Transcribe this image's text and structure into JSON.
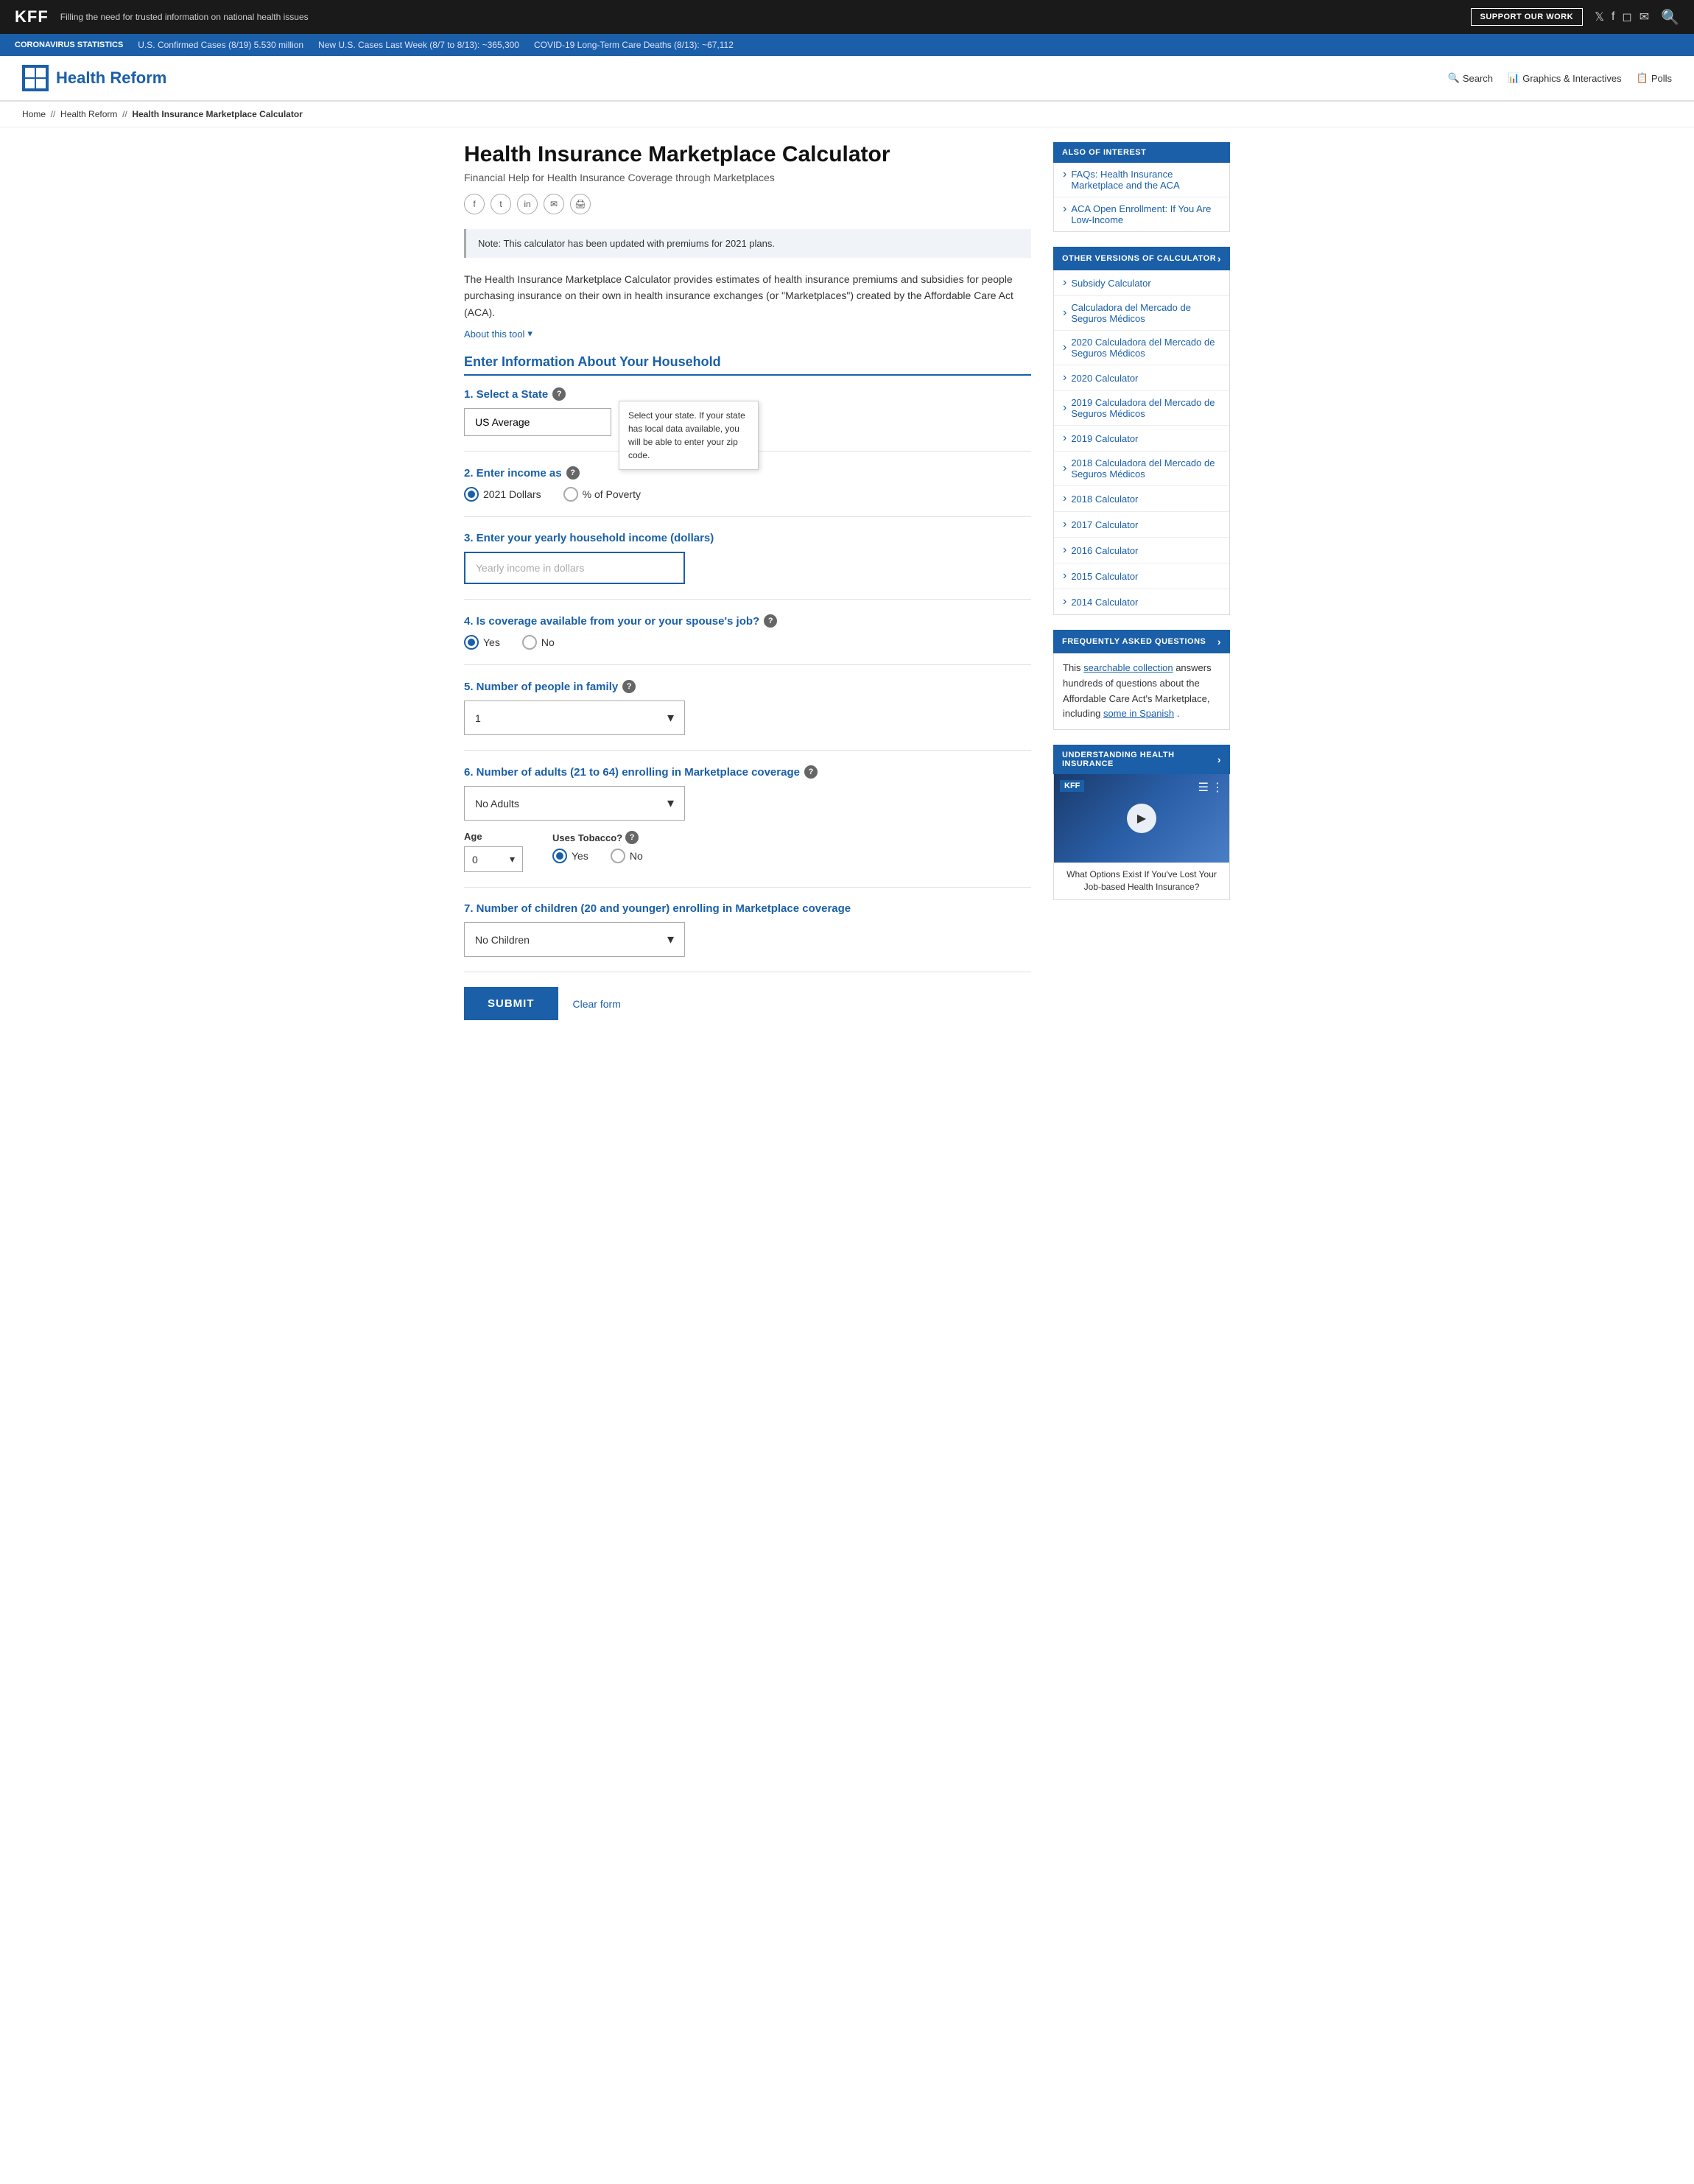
{
  "topbar": {
    "logo": "KFF",
    "tagline": "Filling the need for trusted information on national health issues",
    "support_btn": "SUPPORT OUR WORK"
  },
  "covid_bar": {
    "label": "CORONAVIRUS STATISTICS",
    "stat1": "U.S. Confirmed Cases (8/19) 5.530 million",
    "stat2": "New U.S. Cases Last Week (8/7 to 8/13): ~365,300",
    "stat3": "COVID-19 Long-Term Care Deaths (8/13): ~67,112"
  },
  "hr_nav": {
    "logo_text": "Health Reform",
    "nav_items": [
      "Search",
      "Graphics & Interactives",
      "Polls"
    ]
  },
  "breadcrumb": {
    "home": "Home",
    "section": "Health Reform",
    "current": "Health Insurance Marketplace Calculator"
  },
  "page": {
    "title": "Health Insurance Marketplace Calculator",
    "subtitle": "Financial Help for Health Insurance Coverage through Marketplaces"
  },
  "note": {
    "text": "Note: This calculator has been updated with premiums for 2021 plans."
  },
  "description": {
    "text": "The Health Insurance Marketplace Calculator provides estimates of health insurance premiums and subsidies for people purchasing insurance on their own in health insurance exchanges (or \"Marketplaces\") created by the Affordable Care Act (ACA).",
    "about_link": "About this tool"
  },
  "form": {
    "section_header": "Enter Information About Your Household",
    "field1": {
      "label": "1. Select a State",
      "tooltip": "Select your state. If your state has local data available, you will be able to enter your zip code.",
      "value": "US Average"
    },
    "field2": {
      "label": "2. Enter income as",
      "options": [
        "2021 Dollars",
        "% of Poverty"
      ],
      "selected": "2021 Dollars"
    },
    "field3": {
      "label": "3. Enter your yearly household income (dollars)",
      "placeholder": "Yearly income in dollars"
    },
    "field4": {
      "label": "4. Is coverage available from your or your spouse's job?",
      "options": [
        "Yes",
        "No"
      ],
      "selected": "Yes"
    },
    "field5": {
      "label": "5. Number of people in family",
      "value": "1"
    },
    "field6": {
      "label": "6. Number of adults (21 to 64) enrolling in Marketplace coverage",
      "value": "No Adults",
      "age_label": "Age",
      "age_value": "0",
      "tobacco_label": "Uses Tobacco?",
      "tobacco_options": [
        "Yes",
        "No"
      ],
      "tobacco_selected": "Yes"
    },
    "field7": {
      "label": "7. Number of children (20 and younger) enrolling in Marketplace coverage",
      "value": "No Children"
    },
    "submit_btn": "SUBMIT",
    "clear_link": "Clear form"
  },
  "sidebar": {
    "also_of_interest": {
      "header": "ALSO OF INTEREST",
      "items": [
        "FAQs: Health Insurance Marketplace and the ACA",
        "ACA Open Enrollment: If You Are Low-Income"
      ]
    },
    "other_versions": {
      "header": "OTHER VERSIONS OF CALCULATOR",
      "items": [
        "Subsidy Calculator",
        "Calculadora del Mercado de Seguros Médicos",
        "2020 Calculadora del Mercado de Seguros Médicos",
        "2020 Calculator",
        "2019 Calculadora del Mercado de Seguros Médicos",
        "2019 Calculator",
        "2018 Calculadora del Mercado de Seguros Médicos",
        "2018 Calculator",
        "2017 Calculator",
        "2016 Calculator",
        "2015 Calculator",
        "2014 Calculator"
      ]
    },
    "faq": {
      "header": "FREQUENTLY ASKED QUESTIONS",
      "text_part1": "This ",
      "link": "searchable collection",
      "text_part2": " answers hundreds of questions about the Affordable Care Act's Marketplace, including ",
      "link2": "some in Spanish",
      "text_part3": "."
    },
    "video": {
      "header": "UNDERSTANDING HEALTH INSURANCE",
      "kff_label": "KFF",
      "title_text": "What options exist...",
      "caption": "What Options Exist If You've Lost Your Job-based Health Insurance?"
    }
  }
}
